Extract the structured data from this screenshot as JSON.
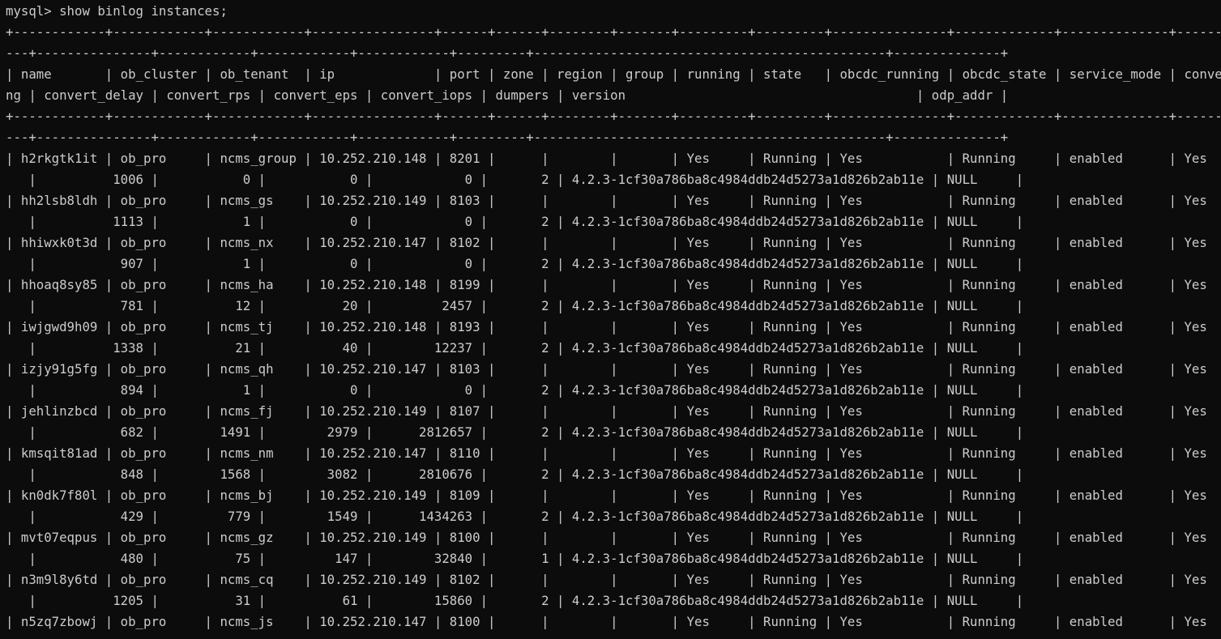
{
  "terminal": {
    "lines": [
      "mysql> show binlog instances;",
      "+------------+------------+------------+----------------+------+------+--------+-------+---------+---------+---------------+-------------+--------------+--------------",
      "---+---------------+------------+------------+------------+---------+----------------------------------------------+--------------+",
      "| name       | ob_cluster | ob_tenant  | ip             | port | zone | region | group | running | state   | obcdc_running | obcdc_state | service_mode | convert_runni",
      "ng | convert_delay | convert_rps | convert_eps | convert_iops | dumpers | version                                      | odp_addr |",
      "+------------+------------+------------+----------------+------+------+--------+-------+---------+---------+---------------+-------------+--------------+--------------",
      "---+---------------+------------+------------+------------+---------+----------------------------------------------+--------------+",
      "| h2rkgtk1it | ob_pro     | ncms_group | 10.252.210.148 | 8201 |      |        |       | Yes     | Running | Yes           | Running     | enabled      | Yes",
      "   |          1006 |           0 |           0 |            0 |       2 | 4.2.3-1cf30a786ba8c4984ddb24d5273a1d826b2ab11e | NULL     |",
      "| hh2lsb8ldh | ob_pro     | ncms_gs    | 10.252.210.149 | 8103 |      |        |       | Yes     | Running | Yes           | Running     | enabled      | Yes",
      "   |          1113 |           1 |           0 |            0 |       2 | 4.2.3-1cf30a786ba8c4984ddb24d5273a1d826b2ab11e | NULL     |",
      "| hhiwxk0t3d | ob_pro     | ncms_nx    | 10.252.210.147 | 8102 |      |        |       | Yes     | Running | Yes           | Running     | enabled      | Yes",
      "   |           907 |           1 |           0 |            0 |       2 | 4.2.3-1cf30a786ba8c4984ddb24d5273a1d826b2ab11e | NULL     |",
      "| hhoaq8sy85 | ob_pro     | ncms_ha    | 10.252.210.148 | 8199 |      |        |       | Yes     | Running | Yes           | Running     | enabled      | Yes",
      "   |           781 |          12 |          20 |         2457 |       2 | 4.2.3-1cf30a786ba8c4984ddb24d5273a1d826b2ab11e | NULL     |",
      "| iwjgwd9h09 | ob_pro     | ncms_tj    | 10.252.210.148 | 8193 |      |        |       | Yes     | Running | Yes           | Running     | enabled      | Yes",
      "   |          1338 |          21 |          40 |        12237 |       2 | 4.2.3-1cf30a786ba8c4984ddb24d5273a1d826b2ab11e | NULL     |",
      "| izjy91g5fg | ob_pro     | ncms_qh    | 10.252.210.147 | 8103 |      |        |       | Yes     | Running | Yes           | Running     | enabled      | Yes",
      "   |           894 |           1 |           0 |            0 |       2 | 4.2.3-1cf30a786ba8c4984ddb24d5273a1d826b2ab11e | NULL     |",
      "| jehlinzbcd | ob_pro     | ncms_fj    | 10.252.210.149 | 8107 |      |        |       | Yes     | Running | Yes           | Running     | enabled      | Yes",
      "   |           682 |        1491 |        2979 |      2812657 |       2 | 4.2.3-1cf30a786ba8c4984ddb24d5273a1d826b2ab11e | NULL     |",
      "| kmsqit81ad | ob_pro     | ncms_nm    | 10.252.210.147 | 8110 |      |        |       | Yes     | Running | Yes           | Running     | enabled      | Yes",
      "   |           848 |        1568 |        3082 |      2810676 |       2 | 4.2.3-1cf30a786ba8c4984ddb24d5273a1d826b2ab11e | NULL     |",
      "| kn0dk7f80l | ob_pro     | ncms_bj    | 10.252.210.149 | 8109 |      |        |       | Yes     | Running | Yes           | Running     | enabled      | Yes",
      "   |           429 |         779 |        1549 |      1434263 |       2 | 4.2.3-1cf30a786ba8c4984ddb24d5273a1d826b2ab11e | NULL     |",
      "| mvt07eqpus | ob_pro     | ncms_gz    | 10.252.210.149 | 8100 |      |        |       | Yes     | Running | Yes           | Running     | enabled      | Yes",
      "   |           480 |          75 |         147 |        32840 |       1 | 4.2.3-1cf30a786ba8c4984ddb24d5273a1d826b2ab11e | NULL     |",
      "| n3m9l8y6td | ob_pro     | ncms_cq    | 10.252.210.149 | 8102 |      |        |       | Yes     | Running | Yes           | Running     | enabled      | Yes",
      "   |          1205 |          31 |          61 |        15860 |       2 | 4.2.3-1cf30a786ba8c4984ddb24d5273a1d826b2ab11e | NULL     |",
      "| n5zq7zbowj | ob_pro     | ncms_js    | 10.252.210.147 | 8100 |      |        |       | Yes     | Running | Yes           | Running     | enabled      | Yes"
    ]
  }
}
